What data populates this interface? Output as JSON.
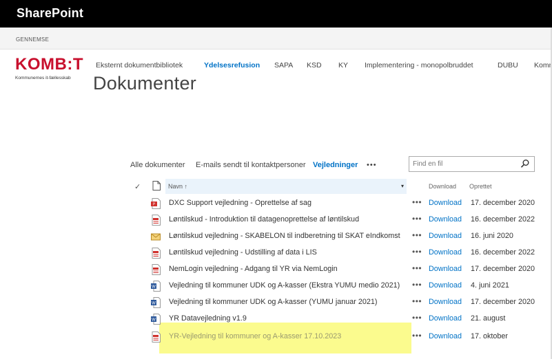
{
  "suitebar": {
    "brand": "SharePoint"
  },
  "ribbon": {
    "browse": "GENNEMSE"
  },
  "logo": {
    "mark": "KOMB:T",
    "sub": "Kommunernes it-fællesskab"
  },
  "topnav": [
    {
      "label": "Eksternt dokumentbibliotek",
      "active": false
    },
    {
      "label": "Ydelsesrefusion",
      "active": true
    },
    {
      "label": "SAPA",
      "active": false
    },
    {
      "label": "KSD",
      "active": false
    },
    {
      "label": "KY",
      "active": false
    },
    {
      "label": "Implementering - monopolbruddet",
      "active": false
    },
    {
      "label": "DUBU",
      "active": false
    },
    {
      "label": "Komm",
      "active": false
    }
  ],
  "page_title": "Dokumenter",
  "views": {
    "all": "Alle dokumenter",
    "emails": "E-mails sendt til kontaktpersoner",
    "guides": "Vejledninger",
    "more": "•••"
  },
  "search": {
    "placeholder": "Find en fil"
  },
  "columns": {
    "check": "✓",
    "name": "Navn ↑",
    "download": "Download",
    "created": "Oprettet"
  },
  "rows": [
    {
      "icon": "pdf",
      "name": "DXC Support vejledning - Oprettelse af sag",
      "dots": "•••",
      "download": "Download",
      "created": "17. december 2020"
    },
    {
      "icon": "pdf-doc",
      "name": "Løntilskud - Introduktion til datagenoprettelse af løntilskud",
      "dots": "•••",
      "download": "Download",
      "created": "16. december 2022"
    },
    {
      "icon": "mail",
      "name": "Løntilskud vejledning - SKABELON til indberetning til SKAT eIndkomst",
      "dots": "•••",
      "download": "Download",
      "created": "16. juni 2020"
    },
    {
      "icon": "pdf-doc",
      "name": "Løntilskud vejledning - Udstilling af data i LIS",
      "dots": "•••",
      "download": "Download",
      "created": "16. december 2022"
    },
    {
      "icon": "pdf-doc",
      "name": "NemLogin vejledning - Adgang til YR via NemLogin",
      "dots": "•••",
      "download": "Download",
      "created": "17. december 2020"
    },
    {
      "icon": "word",
      "name": "Vejledning til kommuner UDK og A-kasser (Ekstra YUMU medio 2021)",
      "dots": "•••",
      "download": "Download",
      "created": "4. juni 2021"
    },
    {
      "icon": "word",
      "name": "Vejledning til kommuner UDK og A-kasser (YUMU januar 2021)",
      "dots": "•••",
      "download": "Download",
      "created": "17. december 2020"
    },
    {
      "icon": "word",
      "name": "YR Datavejledning v1.9",
      "dots": "•••",
      "download": "Download",
      "created": "21. august"
    },
    {
      "icon": "pdf-doc",
      "name": "YR-Vejledning til kommuner og A-kasser 17.10.2023",
      "dots": "•••",
      "download": "Download",
      "created": "17. oktober"
    }
  ],
  "colors": {
    "accent": "#0072c6",
    "brand_red": "#c8102e",
    "highlight": "#fafa7a"
  }
}
